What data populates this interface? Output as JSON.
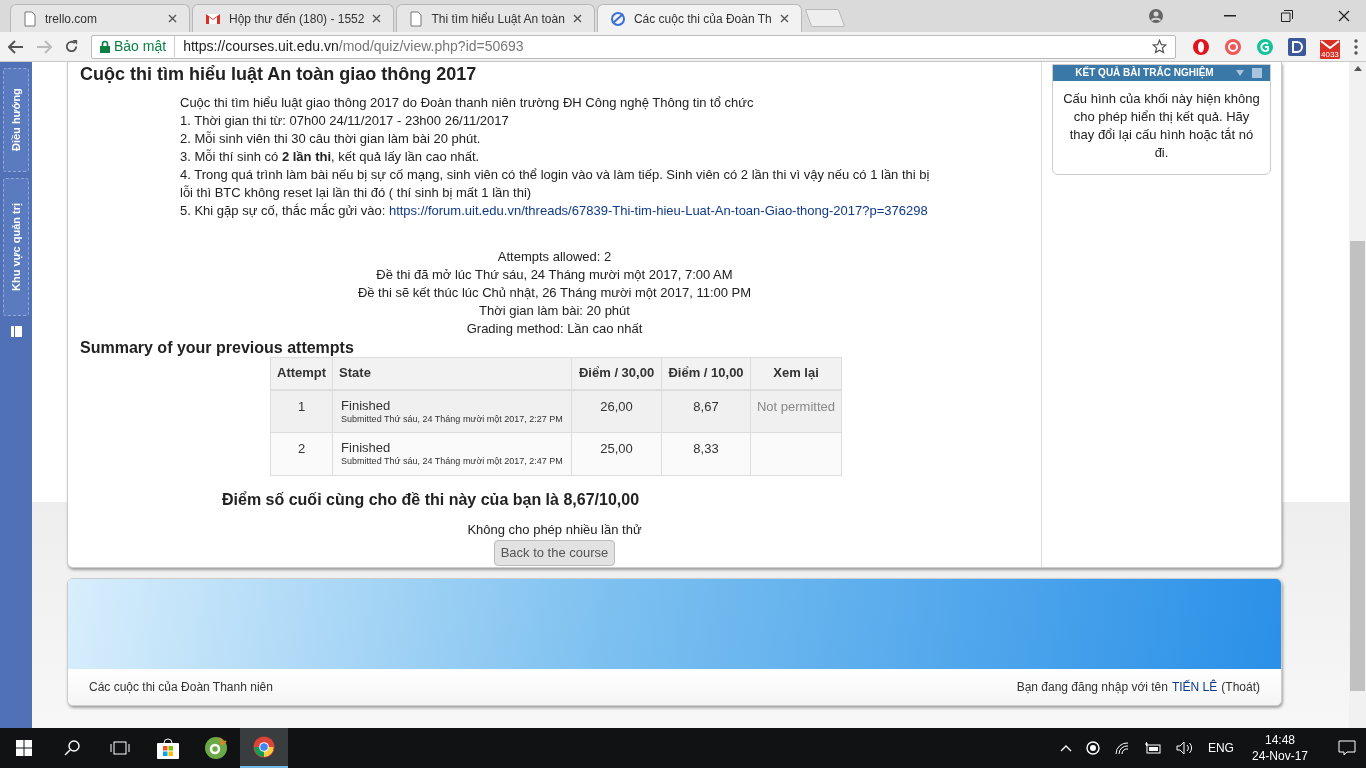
{
  "browser": {
    "tabs": [
      {
        "title": "trello.com",
        "kind": "page",
        "selected": false
      },
      {
        "title": "Hộp thư đến (180) - 1552",
        "kind": "mail",
        "selected": false
      },
      {
        "title": "Thi tìm hiểu Luật An toàn",
        "kind": "page",
        "selected": false
      },
      {
        "title": "Các cuộc thi của Đoàn Th",
        "kind": "site",
        "selected": true
      }
    ],
    "security_label": "Bảo mật",
    "url_host": "https://courses.uit.edu.vn",
    "url_path": "/mod/quiz/view.php?id=50693",
    "extensions": [
      {
        "kind": "opera"
      },
      {
        "kind": "red"
      },
      {
        "kind": "grammar"
      },
      {
        "kind": "dict"
      },
      {
        "kind": "mail",
        "badge": "4033"
      }
    ]
  },
  "sidebar": {
    "items": [
      {
        "label": "Điều hướng"
      },
      {
        "label": "Khu vực quản trị"
      }
    ]
  },
  "page": {
    "heading": "Cuộc thi tìm hiểu luật An toàn giao thông 2017",
    "intro": [
      "Cuộc thi tìm hiểu luật giao thông 2017 do Đoàn thanh niên trường ĐH Công nghệ Thông tin tổ chức",
      "1. Thời gian thi từ: 07h00 24/11/2017 - 23h00 26/11/2017",
      "2. Mỗi sinh viên thi 30 câu thời gian làm bài 20 phút.",
      "3. Mỗi thí sinh có **2 lần thi**, kết quả lấy lần cao nhất.",
      "4. Trong quá trình làm bài nếu bị sự cố mạng, sinh viên có thể login vào và làm tiếp. Sinh viên có 2 lần thi vì vậy nếu có 1 lần thi bị lỗi thì BTC không reset lại lần thi đó ( thí sinh bị mất 1 lần thi)"
    ],
    "contact_prefix": "5. Khi gặp sự cố, thắc mắc gửi vào:",
    "contact_link": "https://forum.uit.edu.vn/threads/67839-Thi-tim-hieu-Luat-An-toan-Giao-thong-2017?p=376298",
    "info": [
      "Attempts allowed: 2",
      "Đề thi đã mở lúc Thứ sáu, 24 Tháng mười một 2017, 7:00 AM",
      "Đề thi sẽ kết thúc lúc Chủ nhật, 26 Tháng mười một 2017, 11:00 PM",
      "Thời gian làm bài: 20 phút",
      "Grading method: Lần cao nhất"
    ],
    "summary_title": "Summary of your previous attempts",
    "table": {
      "columns": [
        "Attempt",
        "State",
        "Điểm / 30,00",
        "Điểm / 10,00",
        "Xem lại"
      ],
      "rows": [
        {
          "attempt": "1",
          "state": "Finished",
          "submitted": "Submitted Thứ sáu, 24 Tháng mười một 2017, 2:27 PM",
          "score30": "26,00",
          "score10": "8,67",
          "review": "Not permitted"
        },
        {
          "attempt": "2",
          "state": "Finished",
          "submitted": "Submitted Thứ sáu, 24 Tháng mười một 2017, 2:47 PM",
          "score30": "25,00",
          "score10": "8,33"
        }
      ]
    },
    "final_grade": "Điểm số cuối cùng cho đề thi này của bạn là 8,67/10,00",
    "note": "Không cho phép nhiều lần thử",
    "back_button": "Back to the course"
  },
  "block": {
    "title": "KẾT QUẢ BÀI TRẮC NGHIỆM",
    "text": "Cấu hình của khối này hiện không cho phép hiển thị kết quả. Hãy thay đổi lại cấu hình hoặc tắt nó đi."
  },
  "footer": {
    "site": "Các cuộc thi của Đoàn Thanh niên",
    "login_prefix": "Bạn đang đăng nhập với tên",
    "user": "TIẾN LÊ",
    "logout": "(Thoát)"
  },
  "taskbar": {
    "apps": [
      {
        "kind": "store",
        "active": false
      },
      {
        "kind": "coccoc",
        "active": false
      },
      {
        "kind": "chrome",
        "active": true
      }
    ],
    "language": "ENG",
    "time": "14:48",
    "date": "24-Nov-17"
  }
}
